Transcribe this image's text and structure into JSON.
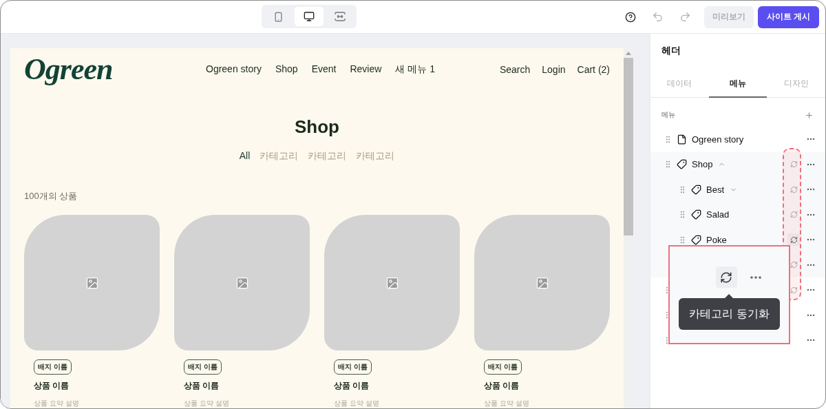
{
  "toolbar": {
    "devices": [
      {
        "kind": "mobile",
        "selected": false
      },
      {
        "kind": "desktop",
        "selected": true
      },
      {
        "kind": "fit",
        "selected": false
      }
    ],
    "preview_button": "미리보기",
    "publish_button": "사이트 게시"
  },
  "site": {
    "logo": "Ogreen",
    "nav": [
      "Ogreen story",
      "Shop",
      "Event",
      "Review",
      "새 메뉴 1"
    ],
    "nav_right": [
      "Search",
      "Login",
      "Cart (2)"
    ],
    "title": "Shop",
    "categories": [
      {
        "label": "All",
        "selected": true
      },
      {
        "label": "카테고리",
        "selected": false
      },
      {
        "label": "카테고리",
        "selected": false
      },
      {
        "label": "카테고리",
        "selected": false
      }
    ],
    "count": "100개의 상품",
    "products": [
      {
        "badge": "배지 이름",
        "name": "상품 이름",
        "summary": "상품 요약 설명"
      },
      {
        "badge": "배지 이름",
        "name": "상품 이름",
        "summary": "상품 요약 설명"
      },
      {
        "badge": "배지 이름",
        "name": "상품 이름",
        "summary": "상품 요약 설명"
      },
      {
        "badge": "배지 이름",
        "name": "상품 이름",
        "summary": "상품 요약 설명"
      }
    ]
  },
  "panel": {
    "title": "헤더",
    "tabs": [
      {
        "label": "데이터",
        "selected": false
      },
      {
        "label": "메뉴",
        "selected": true
      },
      {
        "label": "디자인",
        "selected": false
      }
    ],
    "section_label": "메뉴",
    "menu": [
      {
        "label": "Ogreen story",
        "kind": "page"
      },
      {
        "label": "Shop",
        "kind": "tag",
        "sync": true,
        "hovered": false,
        "expanded": true,
        "children": [
          {
            "label": "Best",
            "kind": "tag",
            "sync": true,
            "hovered": false,
            "expanded": false
          },
          {
            "label": "Salad",
            "kind": "tag",
            "sync": true,
            "hovered": false
          },
          {
            "label": "Poke",
            "kind": "tag",
            "sync": true,
            "hovered": true
          },
          {
            "kind": "hidden",
            "sync": true,
            "hovered": false
          }
        ]
      },
      {
        "kind": "hidden",
        "sync": true,
        "hovered": false
      },
      {
        "kind": "hidden"
      },
      {
        "kind": "hidden"
      }
    ],
    "callout": {
      "tooltip": "카테고리 동기화"
    }
  }
}
